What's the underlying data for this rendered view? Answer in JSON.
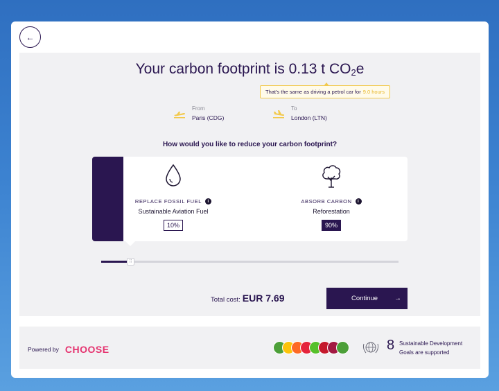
{
  "header": {
    "back_label": "←"
  },
  "title": {
    "prefix": "Your carbon footprint is 0.13 t CO",
    "sub": "2",
    "suffix": "e"
  },
  "tooltip": {
    "text": "That's the same as driving a petrol car for",
    "highlight": "9.0 hours"
  },
  "route": {
    "from": {
      "label": "From",
      "value": "Paris (CDG)",
      "icon": "airplane-departure-icon"
    },
    "to": {
      "label": "To",
      "value": "London (LTN)",
      "icon": "airplane-arrival-icon"
    }
  },
  "question": "How would you like to reduce your carbon footprint?",
  "options": [
    {
      "kicker": "REPLACE FOSSIL FUEL",
      "info": "i",
      "name": "Sustainable Aviation Fuel",
      "percent": "10%",
      "icon": "droplet-icon"
    },
    {
      "kicker": "ABSORB CARBON",
      "info": "i",
      "name": "Reforestation",
      "percent": "90%",
      "icon": "tree-icon"
    }
  ],
  "slider": {
    "value_fraction": 0.1,
    "handle_glyph": "⠿"
  },
  "total": {
    "label": "Total cost:",
    "amount": "EUR 7.69"
  },
  "continue": {
    "label": "Continue",
    "arrow": "→"
  },
  "footer": {
    "powered_by": "Powered by",
    "logo": "CHOOSE",
    "sdg_colors": [
      "#4c9f38",
      "#fcc30b",
      "#fd6925",
      "#e5243b",
      "#56c02b",
      "#c5192d",
      "#a21942",
      "#4c9f38"
    ],
    "sdg_count": "8",
    "sdg_line1": "Sustainable Development",
    "sdg_line2": "Goals are supported"
  },
  "colors": {
    "brand": "#2a1650",
    "accent": "#e5336f",
    "highlight": "#f2c94c"
  }
}
